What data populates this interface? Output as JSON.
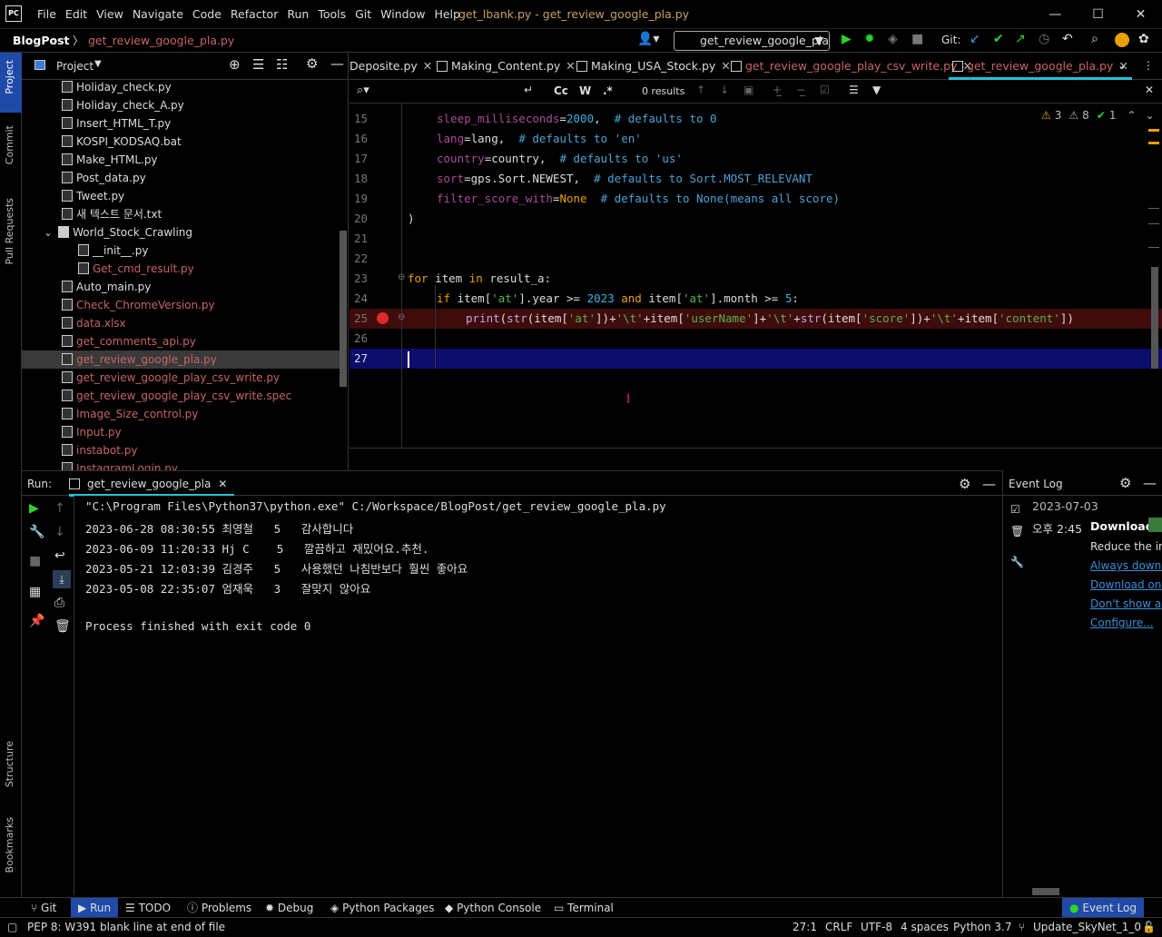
{
  "titlebar": {
    "menu": [
      "File",
      "Edit",
      "View",
      "Navigate",
      "Code",
      "Refactor",
      "Run",
      "Tools",
      "Git",
      "Window",
      "Help"
    ],
    "title": "get_lbank.py - get_review_google_pla.py"
  },
  "nav": {
    "project": "BlogPost",
    "file": "get_review_google_pla.py",
    "run_config": "get_review_google_pla",
    "git_label": "Git:"
  },
  "project_panel": {
    "title": "Project",
    "items": [
      {
        "label": "Holiday_check.py",
        "color": "#dddddd"
      },
      {
        "label": "Holiday_check_A.py",
        "color": "#dddddd"
      },
      {
        "label": "Insert_HTML_T.py",
        "color": "#dddddd"
      },
      {
        "label": "KOSPI_KODSAQ.bat",
        "color": "#dddddd"
      },
      {
        "label": "Make_HTML.py",
        "color": "#dddddd"
      },
      {
        "label": "Post_data.py",
        "color": "#dddddd"
      },
      {
        "label": "Tweet.py",
        "color": "#dddddd"
      },
      {
        "label": "새 텍스트 문서.txt",
        "color": "#dddddd"
      },
      {
        "label": "World_Stock_Crawling",
        "color": "#dddddd"
      },
      {
        "label": "__init__.py",
        "color": "#dddddd"
      },
      {
        "label": "Get_cmd_result.py",
        "color": "#c86464"
      },
      {
        "label": "Auto_main.py",
        "color": "#dddddd"
      },
      {
        "label": "Check_ChromeVersion.py",
        "color": "#c86464"
      },
      {
        "label": "data.xlsx",
        "color": "#c86464"
      },
      {
        "label": "get_comments_api.py",
        "color": "#c86464"
      },
      {
        "label": "get_review_google_pla.py",
        "color": "#c86464"
      },
      {
        "label": "get_review_google_play_csv_write.py",
        "color": "#c86464"
      },
      {
        "label": "get_review_google_play_csv_write.spec",
        "color": "#c86464"
      },
      {
        "label": "Image_Size_control.py",
        "color": "#c86464"
      },
      {
        "label": "Input.py",
        "color": "#c86464"
      },
      {
        "label": "instabot.py",
        "color": "#c86464"
      },
      {
        "label": "InstagramLogin.py",
        "color": "#c86464"
      }
    ]
  },
  "tabs": [
    {
      "label": "Deposite.py"
    },
    {
      "label": "Making_Content.py"
    },
    {
      "label": "Making_USA_Stock.py"
    },
    {
      "label": "get_review_google_play_csv_write.py"
    },
    {
      "label": "get_review_google_pla.py"
    }
  ],
  "search": {
    "results": "0 results",
    "cc": "Cc",
    "w": "W",
    "regex": ".*"
  },
  "inspections": {
    "warn": "3",
    "weak": "8",
    "ok": "1"
  },
  "editor": {
    "line_numbers": [
      "15",
      "16",
      "17",
      "18",
      "19",
      "20",
      "21",
      "22",
      "23",
      "24",
      "25",
      "26",
      "27"
    ]
  },
  "code_parts": {
    "l15a": "sleep_milliseconds",
    "l15b": "=",
    "l15c": "2000",
    "l15d": ",  ",
    "l15e": "# defaults to 0",
    "l16a": "lang",
    "l16b": "=lang,  ",
    "l16c": "# defaults to 'en'",
    "l17a": "country",
    "l17b": "=country,  ",
    "l17c": "# defaults to 'us'",
    "l18a": "sort",
    "l18b": "=gps.Sort.NEWEST,  ",
    "l18c": "# defaults to Sort.MOST_RELEVANT",
    "l19a": "filter_score_with",
    "l19b": "=",
    "l19c": "None",
    "l19d": "  ",
    "l19e": "# defaults to None(means all score)",
    "l20": ")",
    "l23a": "for",
    "l23b": " item ",
    "l23c": "in",
    "l23d": " result_a:",
    "l24a": "if",
    "l24b": " item[",
    "l24c": "'at'",
    "l24d": "].year >= ",
    "l24e": "2023",
    "l24f": " ",
    "l24g": "and",
    "l24h": " item[",
    "l24i": "'at'",
    "l24j": "].month >= ",
    "l24k": "5",
    "l24l": ":",
    "l25a": "print",
    "l25b": "(",
    "l25c": "str",
    "l25d": "(item[",
    "l25e": "'at'",
    "l25f": "])+",
    "l25g": "'\\t'",
    "l25h": "+item[",
    "l25i": "'userName'",
    "l25j": "]+",
    "l25k": "'\\t'",
    "l25l": "+",
    "l25m": "str",
    "l25n": "(item[",
    "l25o": "'score'",
    "l25p": "])+",
    "l25q": "'\\t'",
    "l25r": "+item[",
    "l25s": "'content'",
    "l25t": "])"
  },
  "run": {
    "label": "Run:",
    "tab": "get_review_google_pla",
    "lines": [
      "\"C:\\Program Files\\Python37\\python.exe\" C:/Workspace/BlogPost/get_review_google_pla.py",
      "2023-06-28 08:30:55 최영철   5   감사합니다",
      "2023-06-09 11:20:33 Hj C    5   깔끔하고 재밌어요.추천.",
      "2023-05-21 12:03:39 김경주   5   사용했던 나침반보다 훨씬 좋아요",
      "2023-05-08 22:35:07 엄재욱   3   잘맞지 않아요",
      "",
      "Process finished with exit code 0"
    ]
  },
  "event_log": {
    "title": "Event Log",
    "date": "2023-07-03",
    "time": "오후 2:45",
    "head": "Download",
    "text": "Reduce the ind",
    "links": [
      "Always downl",
      "Download onc",
      "Don't show ag",
      "Configure..."
    ]
  },
  "tool_windows": [
    "Git",
    "Run",
    "TODO",
    "Problems",
    "Debug",
    "Python Packages",
    "Python Console",
    "Terminal",
    "Event Log"
  ],
  "left_strip": [
    "Project",
    "Commit",
    "Pull Requests",
    "Structure",
    "Bookmarks"
  ],
  "status": {
    "message": "PEP 8: W391 blank line at end of file",
    "pos": "27:1",
    "eol": "CRLF",
    "enc": "UTF-8",
    "indent": "4 spaces",
    "interp": "Python 3.7",
    "branch": "Update_SkyNet_1_0"
  }
}
